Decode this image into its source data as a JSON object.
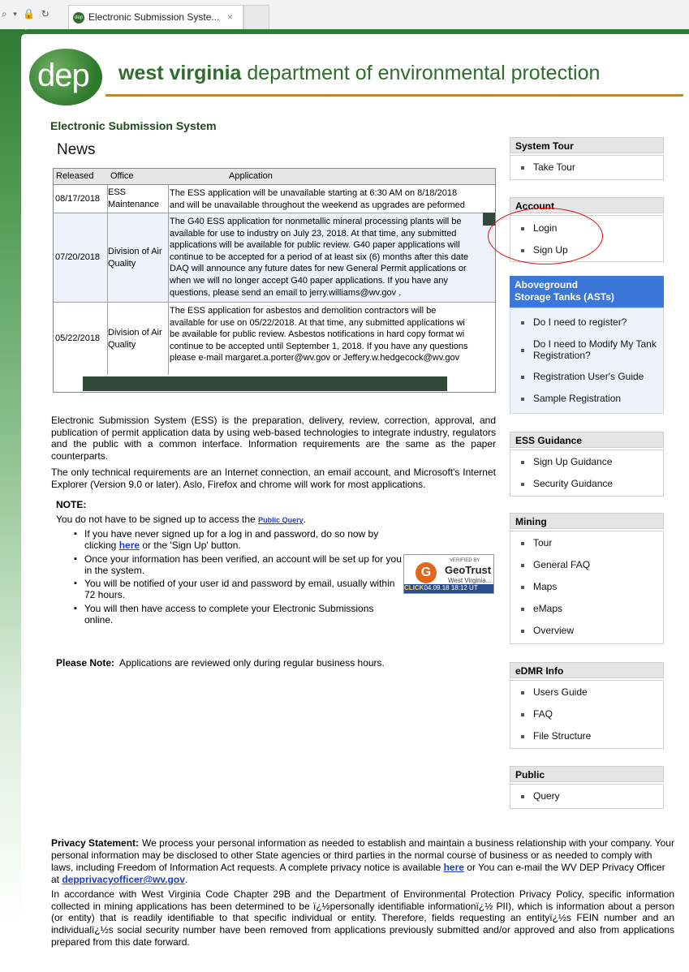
{
  "browser": {
    "tab_title": "Electronic Submission Syste...",
    "favicon_text": "dep",
    "close_glyph": "×",
    "nav_glyphs": "⌕ ▾ 🔒 ↻"
  },
  "header": {
    "logo_text": "dep",
    "dept_name_bold": "west virginia",
    "dept_name_rest": " department of environmental protection",
    "system_title": "Electronic Submission System"
  },
  "news": {
    "title": "News",
    "columns": {
      "released": "Released",
      "office": "Office",
      "application": "Application"
    },
    "rows": [
      {
        "released": "08/17/2018",
        "office": "ESS Maintenance",
        "lines": [
          "The ESS application will be unavailable starting at 6:30 AM on 8/18/2018",
          "and will be unavailable throughout the weekend as upgrades are peformed"
        ]
      },
      {
        "released": "07/20/2018",
        "office": "Division of Air Quality",
        "lines": [
          "The G40 ESS application for nonmetallic mineral processing plants will be",
          "available for use to industry on July 23, 2018. At that time, any submitted",
          "applications will be available for public review. G40 paper applications will",
          "continue to be accepted for a period of at least six (6) months after this date",
          "DAQ will announce any future dates for new General Permit applications or",
          "when we will no longer accept G40 paper applications. If you have any",
          "questions, please send an email to jerry.williams@wv.gov ."
        ]
      },
      {
        "released": "05/22/2018",
        "office": "Division of Air Quality",
        "lines": [
          "The ESS application for asbestos and demolition contractors will be",
          "available for use on 05/22/2018. At that time, any submitted applications wi",
          "be available for public review. Asbestos notifications in hard copy format wi",
          "continue to be accepted until September 1, 2018. If you have any questions",
          "please e-mail margaret.a.porter@wv.gov or Jeffery.w.hedgecock@wv.gov"
        ]
      }
    ]
  },
  "intro": {
    "p1": "Electronic Submission System (ESS) is the preparation, delivery, review, correction, approval, and publication of permit application data by using web-based technologies to integrate industry, regulators and the public with a common interface. Information requirements are the same as the paper counterparts.",
    "p2": "The only technical requirements are an Internet connection, an email account, and Microsoft's Internet Explorer (Version 9.0 or later). Aslo, Firefox and chrome will work for most applications."
  },
  "note": {
    "label": "NOTE:",
    "intro_text": "You do not have to be signed up to access the ",
    "public_query_link": "Public Query",
    "intro_end": ".",
    "bullet1_pre": "If you have never signed up for a log in and password, do so now by clicking ",
    "bullet1_link": "here",
    "bullet1_post": " or the 'Sign Up' button.",
    "bullet2": "Once your information has been verified, an account will be set up for you in the system.",
    "bullet3": "You will be notified of your user id and password by email, usually within 72 hours.",
    "bullet4": "You will then have access to complete your Electronic Submissions online."
  },
  "geotrust": {
    "verified_by": "VERIFIED BY",
    "brand": "GeoTrust",
    "org": "West Virginia...",
    "click": "CLICK",
    "timestamp": "04.09.18 18:12 UT"
  },
  "please_note": {
    "label": "Please Note:",
    "text": "Applications are reviewed only during regular business hours."
  },
  "sidebar": {
    "system_tour": {
      "title": "System Tour",
      "items": [
        "Take Tour"
      ]
    },
    "account": {
      "title": "Account",
      "items": [
        "Login",
        "Sign Up"
      ]
    },
    "asts": {
      "title_line1": "Aboveground",
      "title_line2": "Storage Tanks (ASTs)",
      "items": [
        "Do I need to register?",
        "Do I need to Modify My Tank Registration?",
        "Registration User's Guide",
        "Sample Registration"
      ]
    },
    "ess_guidance": {
      "title": "ESS Guidance",
      "items": [
        "Sign Up Guidance",
        "Security Guidance"
      ]
    },
    "mining": {
      "title": "Mining",
      "items": [
        "Tour",
        "General FAQ",
        "Maps",
        "eMaps",
        "Overview"
      ]
    },
    "edmr": {
      "title": "eDMR Info",
      "items": [
        "Users Guide",
        "FAQ",
        "File Structure"
      ]
    },
    "public": {
      "title": "Public",
      "items": [
        "Query"
      ]
    }
  },
  "footer": {
    "privacy_label": "Privacy Statement:",
    "privacy_text1": "We process your personal information as needed to establish and maintain a business relationship with your company.  Your personal information may be disclosed to other State agencies or third parties in the normal course of business or as needed to comply with laws, including Freedom of Information Act requests.  A complete privacy notice is available ",
    "privacy_here": "here",
    "privacy_text2": " or You can e-mail the WV DEP Privacy Officer at ",
    "privacy_email": "depprivacyofficer@wv.gov",
    "privacy_end": ".",
    "accord": "In accordance with West Virginia Code Chapter 29B and the Department of Environmental Protection Privacy Policy, specific information collected in mining applications has been determined to be ï¿½personally identifiable informationï¿½ PII), which is information about a person (or entity) that is readily identifiable to that specific individual or entity. Therefore, fields requesting an entityï¿½s FEIN number and an individualï¿½s social security number have been removed from applications previously submitted and/or approved and also from applications prepared from this date forward."
  },
  "colors": {
    "brand_green": "#2f7a35",
    "rule_gold": "#b98a2e",
    "ast_blue": "#3a77d8",
    "link_blue": "#1a3fc4",
    "highlight_red": "#dd1111"
  }
}
